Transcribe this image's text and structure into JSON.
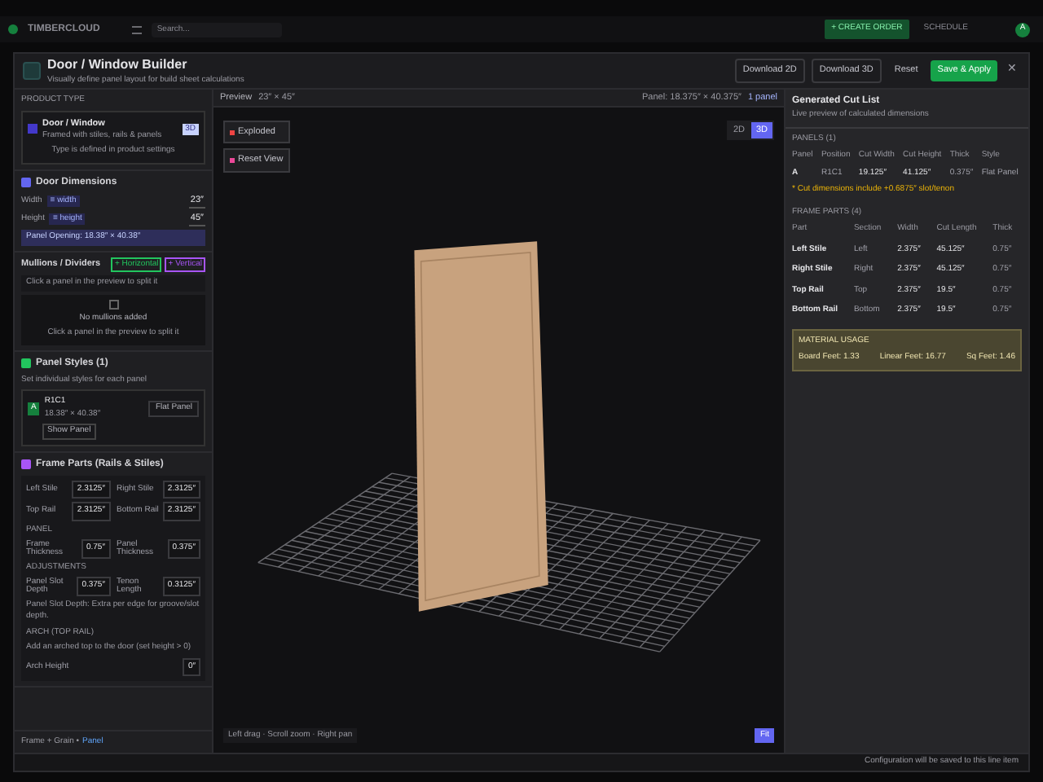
{
  "app_bar": {
    "logo": "TIMBERCLOUD",
    "search": {
      "placeholder": "Search..."
    },
    "create_button": "+ CREATE ORDER",
    "schedule": "SCHEDULE",
    "avatar": "A"
  },
  "modal": {
    "title": "Door / Window Builder",
    "subtitle": "Visually define panel layout for build sheet calculations",
    "actions": [
      {
        "kind": "menu",
        "label": "Download 2D"
      },
      {
        "kind": "menu",
        "label": "Download 3D"
      },
      {
        "kind": "plain",
        "label": "Reset"
      },
      {
        "kind": "primary",
        "label": "Save & Apply"
      }
    ],
    "product_type": {
      "label": "PRODUCT TYPE",
      "name": "Door / Window",
      "description": "Framed with stiles, rails & panels",
      "badge": "3D",
      "note": "Type is defined in product settings"
    },
    "dimensions": {
      "title": "Door Dimensions",
      "fields": [
        {
          "label": "Width",
          "tag": "≡ width",
          "value": "23″"
        },
        {
          "label": "Height",
          "tag": "≡ height",
          "value": "45″"
        }
      ],
      "opening": "Panel Opening: 18.38″ × 40.38″"
    },
    "mullions": {
      "title": "Mullions / Dividers",
      "buttons": [
        {
          "label": "+ Horizontal",
          "color": "#22c55e"
        },
        {
          "label": "+ Vertical",
          "color": "#a855f7"
        }
      ],
      "hint": "Click a panel in the preview to split it",
      "empty_title": "No mullions added",
      "empty_hint": "Click a panel in the preview to split it"
    },
    "panel_styles": {
      "title": "Panel Styles (1)",
      "hint": "Set individual styles for each panel",
      "panels": [
        {
          "badge": "A",
          "name": "R1C1",
          "size": "18.38″ × 40.38″",
          "style": "Flat Panel",
          "button": "Show Panel"
        }
      ]
    },
    "frame_parts": {
      "title": "Frame Parts (Rails & Stiles)",
      "parts": [
        {
          "label": "Left Stile",
          "value": "2.3125″"
        },
        {
          "label": "Right Stile",
          "value": "2.3125″"
        },
        {
          "label": "Top Rail",
          "value": "2.3125″"
        },
        {
          "label": "Bottom Rail",
          "value": "2.3125″"
        }
      ],
      "panel_label": "PANEL",
      "panel_fields": [
        {
          "label": "Frame Thickness",
          "value": "0.75″"
        },
        {
          "label": "Panel Thickness",
          "value": "0.375″"
        }
      ],
      "adjust_label": "ADJUSTMENTS",
      "adjust_fields": [
        {
          "label": "Panel Slot Depth",
          "value": "0.375″"
        },
        {
          "label": "Tenon Length",
          "value": "0.3125″"
        }
      ],
      "adjust_note": "Panel Slot Depth: Extra per edge for groove/slot depth.",
      "arch_label": "ARCH (TOP RAIL)",
      "arch_note": "Add an arched top to the door (set height > 0)",
      "arch_field": {
        "label": "Arch Height",
        "value": "0″"
      }
    },
    "left_footer": {
      "text": "Frame + Grain •",
      "link": "Panel"
    },
    "preview": {
      "label": "Preview",
      "size": "23″ × 45″",
      "panel_info": "Panel: 18.375″ × 40.375″",
      "panel_count": "1 panel",
      "buttons": [
        {
          "label": "Exploded",
          "color": "#ef4444"
        },
        {
          "label": "Reset View",
          "color": "#ec4899"
        }
      ],
      "modes": [
        {
          "label": "2D",
          "selected": false
        },
        {
          "label": "3D",
          "selected": true
        }
      ],
      "hint": "Left drag · Scroll zoom · Right pan",
      "corner_button": "Fit"
    },
    "cut_list": {
      "title": "Generated Cut List",
      "subtitle": "Live preview of calculated dimensions",
      "panels_label": "PANELS (1)",
      "panel_columns": [
        "Panel",
        "Position",
        "Cut Width",
        "Cut Height",
        "Thick",
        "Style"
      ],
      "panel_rows": [
        [
          "A",
          "R1C1",
          "19.125″",
          "41.125″",
          "0.375″",
          "Flat Panel"
        ]
      ],
      "note": "* Cut dimensions include +0.6875″ slot/tenon",
      "frame_label": "FRAME PARTS (4)",
      "frame_columns": [
        "Part",
        "Section",
        "Width",
        "Cut Length",
        "Thick"
      ],
      "frame_rows": [
        [
          "Left Stile",
          "Left",
          "2.375″",
          "45.125″",
          "0.75″"
        ],
        [
          "Right Stile",
          "Right",
          "2.375″",
          "45.125″",
          "0.75″"
        ],
        [
          "Top Rail",
          "Top",
          "2.375″",
          "19.5″",
          "0.75″"
        ],
        [
          "Bottom Rail",
          "Bottom",
          "2.375″",
          "19.5″",
          "0.75″"
        ]
      ],
      "material_label": "MATERIAL USAGE",
      "material": [
        "Board Feet: 1.33",
        "Linear Feet: 16.77",
        "Sq Feet: 1.46"
      ]
    },
    "footer_note": "Configuration will be saved to this line item",
    "close": "✕"
  }
}
